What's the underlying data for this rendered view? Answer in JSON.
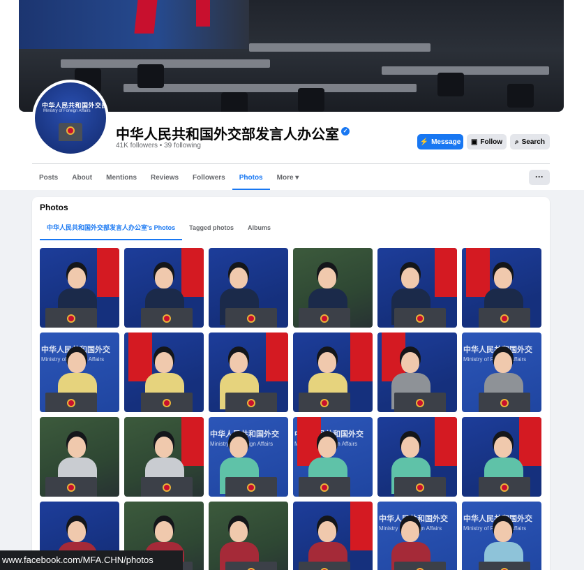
{
  "profile": {
    "name": "中华人民共和国外交部发言人办公室",
    "stats": "41K followers • 39 following",
    "avatar_text_line1": "中华人民共和国外交部",
    "avatar_text_line2": "Ministry of Foreign Affairs"
  },
  "actions": {
    "message": "Message",
    "follow": "Follow",
    "search": "Search",
    "more": "···"
  },
  "tabs": [
    {
      "label": "Posts"
    },
    {
      "label": "About"
    },
    {
      "label": "Mentions"
    },
    {
      "label": "Reviews"
    },
    {
      "label": "Followers"
    },
    {
      "label": "Photos",
      "active": true
    },
    {
      "label": "More ▾"
    }
  ],
  "photos_section": {
    "title": "Photos",
    "sub_tabs": [
      {
        "label": "中华人民共和国外交部发言人办公室's Photos",
        "active": true
      },
      {
        "label": "Tagged photos"
      },
      {
        "label": "Albums"
      }
    ]
  },
  "photo_grid": [
    {
      "bg": "blue",
      "outfit": "#1b2a4a",
      "flag": "right"
    },
    {
      "bg": "blue",
      "outfit": "#1b2a4a",
      "flag": "right"
    },
    {
      "bg": "blue",
      "outfit": "#1b2a4a",
      "flag": "none"
    },
    {
      "bg": "green",
      "outfit": "#1b2a4a",
      "flag": "none"
    },
    {
      "bg": "blue",
      "outfit": "#1b2a4a",
      "flag": "right"
    },
    {
      "bg": "blue",
      "outfit": "#1b2a4a",
      "flag": "left"
    },
    {
      "bg": "text",
      "outfit": "#e6d37d",
      "flag": "none"
    },
    {
      "bg": "blue",
      "outfit": "#e6d37d",
      "flag": "left"
    },
    {
      "bg": "blue",
      "outfit": "#e6d37d",
      "flag": "right"
    },
    {
      "bg": "blue",
      "outfit": "#e6d37d",
      "flag": "right"
    },
    {
      "bg": "blue",
      "outfit": "#8e9297",
      "flag": "left"
    },
    {
      "bg": "text",
      "outfit": "#8e9297",
      "flag": "none"
    },
    {
      "bg": "green",
      "outfit": "#c9ccd1",
      "flag": "none"
    },
    {
      "bg": "green",
      "outfit": "#c9ccd1",
      "flag": "right"
    },
    {
      "bg": "text",
      "outfit": "#5fc2a8",
      "flag": "none"
    },
    {
      "bg": "text",
      "outfit": "#5fc2a8",
      "flag": "left"
    },
    {
      "bg": "blue",
      "outfit": "#5fc2a8",
      "flag": "right"
    },
    {
      "bg": "blue",
      "outfit": "#5fc2a8",
      "flag": "right"
    },
    {
      "bg": "blue",
      "outfit": "#a52a38",
      "flag": "none"
    },
    {
      "bg": "green",
      "outfit": "#a52a38",
      "flag": "none"
    },
    {
      "bg": "green",
      "outfit": "#a52a38",
      "flag": "none"
    },
    {
      "bg": "blue",
      "outfit": "#a52a38",
      "flag": "right"
    },
    {
      "bg": "text",
      "outfit": "#a52a38",
      "flag": "none"
    },
    {
      "bg": "text",
      "outfit": "#8ec3d9",
      "flag": "none"
    }
  ],
  "status_bar": {
    "url": "www.facebook.com/MFA.CHN/photos"
  },
  "colors": {
    "accent": "#1877f2",
    "background": "#f0f2f5"
  }
}
